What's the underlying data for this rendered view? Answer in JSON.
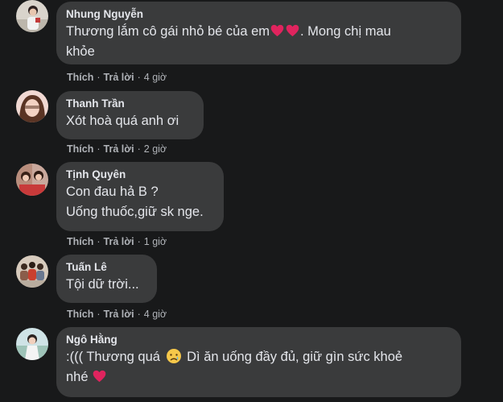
{
  "actions": {
    "like_label": "Thích",
    "reply_label": "Trả lời",
    "separator": "·"
  },
  "comments": [
    {
      "author": "Nhung Nguyễn",
      "text_line1": "Thương lắm cô gái nhỏ bé của em",
      "text_line2": ". Mong chị mau",
      "text_line3": "khỏe",
      "time": "4 giờ",
      "emoji": "red-heart-icon"
    },
    {
      "author": "Thanh Trần",
      "text_line1": "Xót hoà quá anh ơi",
      "time": "2 giờ"
    },
    {
      "author": "Tịnh Quyên",
      "text_line1": "Con đau hả B ?",
      "text_line2": "Uống thuốc,giữ sk nge.",
      "time": "1 giờ"
    },
    {
      "author": "Tuấn Lê",
      "text_line1": "Tội dữ trời...",
      "time": "4 giờ"
    },
    {
      "author": "Ngô Hằng",
      "text_line1a": ":((( Thương quá",
      "text_line1b": "Dì ăn uống đầy đủ, giữ gìn sức khoẻ",
      "text_line2": "nhé",
      "emoji1": "sad-crying-face-icon",
      "emoji2": "red-heart-icon"
    }
  ],
  "colors": {
    "background": "#18191a",
    "bubble": "#3a3b3c",
    "primary_text": "#e4e6eb",
    "secondary_text": "#b0b3b8",
    "heart": "#e0245e"
  }
}
